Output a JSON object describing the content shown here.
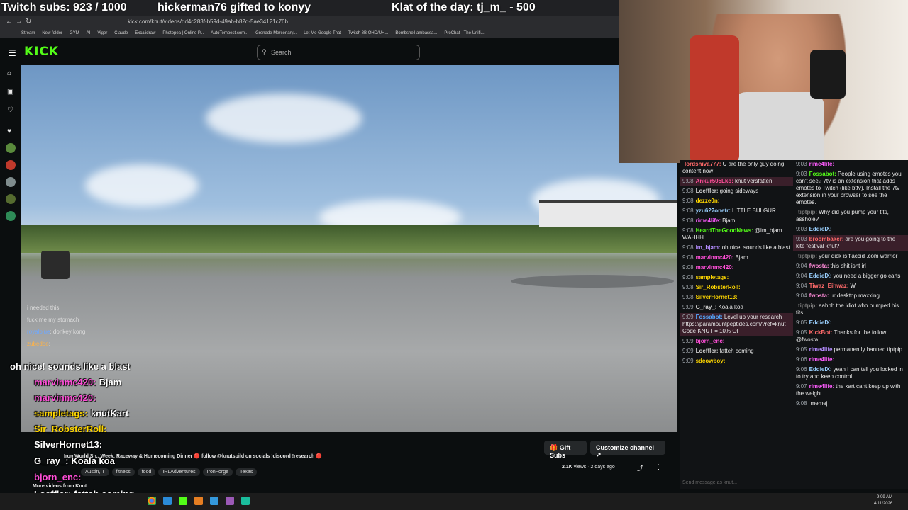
{
  "overlay_banner": {
    "subs": "Twitch subs: 923 / 1000",
    "gift": "hickerman76 gifted to konyy",
    "klat": "Klat of the day: tj_m_ - 500"
  },
  "browser": {
    "url": "kick.com/knut/videos/dd4c283f-b59d-49ab-b82d-5ae34121c76b",
    "bookmarks": [
      "Stream",
      "New folder",
      "GYM",
      "AI",
      "Viger",
      "Claude",
      "Excalidraw",
      "Photopea | Online P...",
      "AutoTempest.com...",
      "Grenade Mercenary...",
      "Let Me Google That",
      "Twitch 8B QHD/UH...",
      "Bombshell ambassa...",
      "ProChat - The Unifi..."
    ]
  },
  "kick": {
    "logo": "KICK",
    "search_placeholder": "Search",
    "title": "Iron World Sh.. Week: Raceway & Homecoming Dinner 🔴 follow @knutspild on socials !discord !research 🔴",
    "views": "2.1K",
    "views_suffix": "views",
    "age": "2 days ago",
    "tags": [
      "Austin, T",
      "fitness",
      "food",
      "IRLAdventures",
      "IronForge",
      "Texas"
    ],
    "gift_subs": "Gift Subs",
    "customize_channel": "Customize channel",
    "more_videos": "More videos from Knut",
    "video_chat": [
      {
        "user": "zubedoo",
        "text": "i needed this"
      },
      {
        "user": "",
        "text": "fuck me my stomach"
      },
      {
        "user": "royalblue",
        "text": "donkey kong"
      },
      {
        "user": "zubedoo",
        "text": ""
      }
    ]
  },
  "overlay_chat": [
    {
      "user": "",
      "text": "oh nice! sounds like a blast",
      "color": "#ffffff"
    },
    {
      "user": "marvinmc420:",
      "text": "Bjam",
      "color": "#ff4fd8"
    },
    {
      "user": "marvinmc420:",
      "text": "",
      "color": "#ff4fd8"
    },
    {
      "user": "sampletags:",
      "text": "knutKart",
      "color": "#ffd700"
    },
    {
      "user": "Sir_RobsterRoll:",
      "text": "",
      "color": "#ffd700"
    },
    {
      "user": "SilverHornet13:",
      "text": "",
      "color": "#ffffff"
    },
    {
      "user": "G_ray_:",
      "text": "Koala koa",
      "color": "#ffffff"
    },
    {
      "user": "bjorn_enc:",
      "text": "",
      "color": "#ff4fd8"
    },
    {
      "user": "Loeffler:",
      "text": "fatteh coming",
      "color": "#ffffff"
    }
  ],
  "chat_left": [
    {
      "time": "",
      "user": "lordshiva777:",
      "text": "U are the only guy doing content now",
      "color": "#ff6a6a",
      "hl": false
    },
    {
      "time": "9:08",
      "user": "Ankur505Lko:",
      "text": "knut versfatten",
      "color": "#ff4f9a",
      "hl": true
    },
    {
      "time": "9:08",
      "user": "Loeffler:",
      "text": "going sideways",
      "color": "#cfcfcf",
      "hl": false
    },
    {
      "time": "9:08",
      "user": "dezze0n:",
      "text": "",
      "color": "#ffd700",
      "hl": false
    },
    {
      "time": "9:08",
      "user": "yzu627onetr:",
      "text": "LITTLE BULGUR",
      "color": "#9ad0ff",
      "hl": false
    },
    {
      "time": "9:08",
      "user": "rime4life:",
      "text": "Bjam",
      "color": "#ff5cff",
      "hl": false
    },
    {
      "time": "9:08",
      "user": "HeardTheGoodNews:",
      "text": "@im_bjam WAHHH",
      "color": "#53fc18",
      "hl": false
    },
    {
      "time": "9:08",
      "user": "im_bjam:",
      "text": "oh nice! sounds like a blast",
      "color": "#b48cff",
      "hl": false
    },
    {
      "time": "9:08",
      "user": "marvinmc420:",
      "text": "Bjam",
      "color": "#ff4fd8",
      "hl": false
    },
    {
      "time": "9:08",
      "user": "marvinmc420:",
      "text": "",
      "color": "#ff4fd8",
      "hl": false
    },
    {
      "time": "9:08",
      "user": "sampletags:",
      "text": "",
      "color": "#ffd700",
      "hl": false
    },
    {
      "time": "9:08",
      "user": "Sir_RobsterRoll:",
      "text": "",
      "color": "#ffd700",
      "hl": false
    },
    {
      "time": "9:08",
      "user": "SilverHornet13:",
      "text": "",
      "color": "#ffd700",
      "hl": false
    },
    {
      "time": "9:09",
      "user": "G_ray_:",
      "text": "Koala koa",
      "color": "#cfcfcf",
      "hl": false
    },
    {
      "time": "9:09",
      "user": "Fossabot:",
      "text": "Level up your research https://paramountpeptides.com/?ref=knut Code KNUT = 10% OFF",
      "color": "#53a8ff",
      "hl": true
    },
    {
      "time": "9:09",
      "user": "bjorn_enc:",
      "text": "",
      "color": "#ff4fd8",
      "hl": false
    },
    {
      "time": "9:09",
      "user": "Loeffler:",
      "text": "fatteh coming",
      "color": "#cfcfcf",
      "hl": false
    },
    {
      "time": "9:09",
      "user": "sdcowboy:",
      "text": "",
      "color": "#ffd700",
      "hl": false
    }
  ],
  "chat_right": [
    {
      "time": "9:03",
      "user": "rime4life:",
      "text": "",
      "color": "#ff5cff",
      "hl": false
    },
    {
      "time": "9:03",
      "user": "Fossabot:",
      "text": "People using emotes you can't see? 7tv is an extension that adds emotes to Twitch (like bttv). Install the 7tv extension in your browser to see the emotes.",
      "color": "#53fc18",
      "hl": false
    },
    {
      "time": "",
      "user": "tiptpip:",
      "text": "Why did you pump your tits, asshole?",
      "color": "#777777",
      "hl": false
    },
    {
      "time": "9:03",
      "user": "EddieIX:",
      "text": "",
      "color": "#9ad0ff",
      "hl": false
    },
    {
      "time": "9:03",
      "user": "broombaker:",
      "text": "are you going to the kite festival knut?",
      "color": "#ff6a6a",
      "hl": true
    },
    {
      "time": "",
      "user": "tiptpip:",
      "text": "your dick is flaccid .com warrior",
      "color": "#777777",
      "hl": false
    },
    {
      "time": "9:04",
      "user": "fwosta:",
      "text": "this shit isnt irl",
      "color": "#ff8ad8",
      "hl": false
    },
    {
      "time": "9:04",
      "user": "EddieIX:",
      "text": "you need a bigger go carts",
      "color": "#9ad0ff",
      "hl": false
    },
    {
      "time": "9:04",
      "user": "Tiwaz_Eihwaz:",
      "text": "W",
      "color": "#ff6a6a",
      "hl": false
    },
    {
      "time": "9:04",
      "user": "fwosta:",
      "text": "ur desktop maxxing",
      "color": "#ff8ad8",
      "hl": false
    },
    {
      "time": "",
      "user": "tiptpip:",
      "text": "aahhh the idiot who pumped his tits",
      "color": "#777777",
      "hl": false
    },
    {
      "time": "9:05",
      "user": "EddieIX:",
      "text": "",
      "color": "#9ad0ff",
      "hl": false
    },
    {
      "time": "9:05",
      "user": "KickBot:",
      "text": "Thanks for the follow @fwosta",
      "color": "#ff6a6a",
      "hl": false
    },
    {
      "time": "9:05",
      "user": "rime4life",
      "text": "permanently banned tiptpip.",
      "color": "#b48cff",
      "hl": false
    },
    {
      "time": "9:06",
      "user": "rime4life:",
      "text": "",
      "color": "#ff5cff",
      "hl": false
    },
    {
      "time": "9:06",
      "user": "EddieIX:",
      "text": "yeah I can tell you locked in to try and keep control",
      "color": "#9ad0ff",
      "hl": false
    },
    {
      "time": "9:07",
      "user": "rime4life:",
      "text": "the kart cant keep up with the weight",
      "color": "#ff5cff",
      "hl": false
    },
    {
      "time": "9:08",
      "user": "",
      "text": "memej",
      "color": "#cfcfcf",
      "hl": false
    }
  ],
  "chat_input_placeholder": "Send message as knut...",
  "taskbar": {
    "time": "9:09 AM",
    "date": "4/11/2026"
  },
  "colors": {
    "kick_green": "#53fc18",
    "bg": "#0b0e0f",
    "chat_bg": "#111315"
  }
}
